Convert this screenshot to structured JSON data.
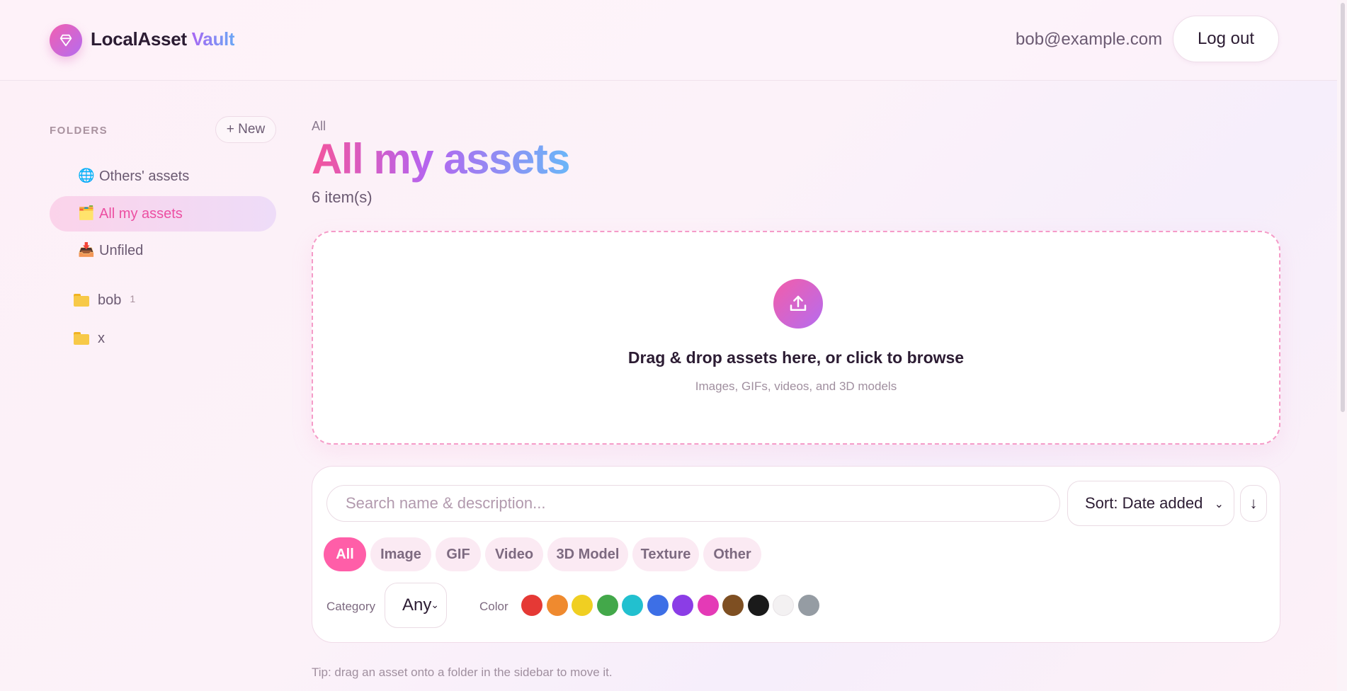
{
  "header": {
    "brand_part1": "LocalAsset",
    "brand_part2": "Vault",
    "user_email": "bob@example.com",
    "logout_label": "Log out"
  },
  "sidebar": {
    "heading": "FOLDERS",
    "new_label": "+ New",
    "views": [
      {
        "icon": "globe-icon",
        "glyph": "🌐",
        "label": "Others' assets"
      },
      {
        "icon": "folder-icon",
        "glyph": "🗂️",
        "label": "All my assets",
        "active": true
      },
      {
        "icon": "inbox-icon",
        "glyph": "📥",
        "label": "Unfiled"
      }
    ],
    "folders": [
      {
        "label": "bob",
        "count": "1"
      },
      {
        "label": "x",
        "count": ""
      }
    ]
  },
  "main": {
    "breadcrumb": "All",
    "title": "All my assets",
    "item_count": "6 item(s)",
    "dropzone": {
      "title": "Drag & drop assets here, or click to browse",
      "subtitle": "Images, GIFs, videos, and 3D models"
    },
    "filters": {
      "search_placeholder": "Search name & description...",
      "sort_value": "Sort: Date added",
      "sort_dir": "↓",
      "types": [
        "All",
        "Image",
        "GIF",
        "Video",
        "3D Model",
        "Texture",
        "Other"
      ],
      "active_type": "All",
      "category_label": "Category",
      "category_value": "Any",
      "color_label": "Color",
      "colors": [
        "#e53935",
        "#ef8a2f",
        "#f0cf22",
        "#43a84a",
        "#22c0cf",
        "#3d6fe6",
        "#8b3de6",
        "#e43ab6",
        "#7e4f22",
        "#1a1a1a",
        "#f3f1f2",
        "#959ca3"
      ]
    },
    "tip": "Tip: drag an asset onto a folder in the sidebar to move it."
  }
}
